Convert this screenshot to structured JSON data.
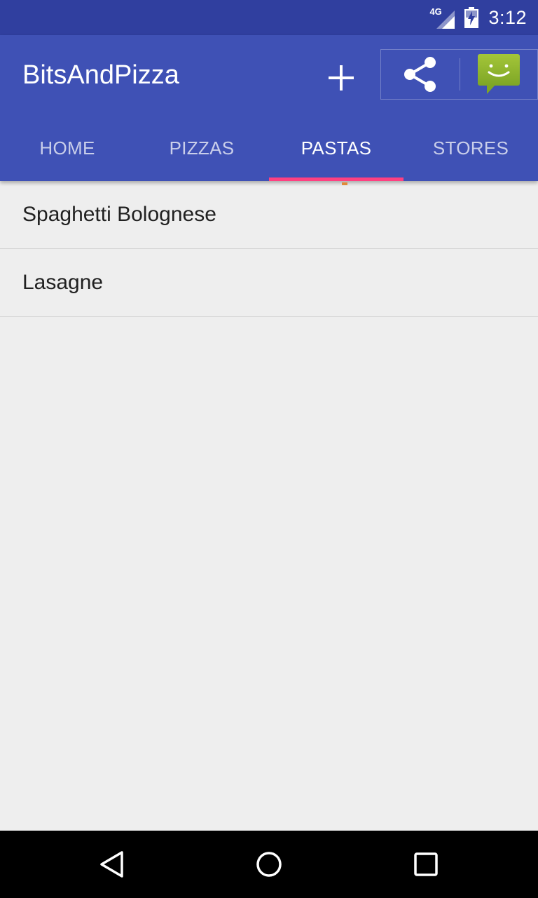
{
  "status_bar": {
    "network": "4G",
    "time": "3:12"
  },
  "app_bar": {
    "title": "BitsAndPizza",
    "actions": {
      "add_icon": "plus-icon",
      "share_icon": "share-icon",
      "message_icon": "message-smiley-icon"
    }
  },
  "tabs": [
    {
      "label": "HOME",
      "active": false
    },
    {
      "label": "PIZZAS",
      "active": false
    },
    {
      "label": "PASTAS",
      "active": true
    },
    {
      "label": "STORES",
      "active": false
    }
  ],
  "list": {
    "items": [
      {
        "label": "Spaghetti Bolognese"
      },
      {
        "label": "Lasagne"
      }
    ]
  },
  "nav_bar": {
    "back_icon": "back-triangle-icon",
    "home_icon": "home-circle-icon",
    "recents_icon": "recents-square-icon"
  },
  "colors": {
    "primary": "#3f51b5",
    "primary_dark": "#303f9f",
    "accent": "#ff4081",
    "background": "#eeeeee"
  }
}
